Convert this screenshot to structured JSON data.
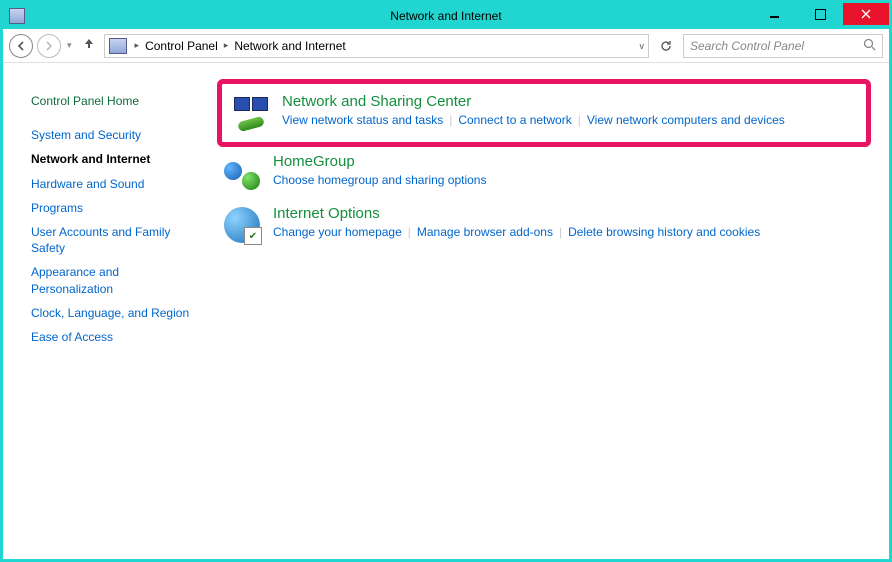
{
  "window": {
    "title": "Network and Internet"
  },
  "breadcrumb": {
    "seg1": "Control Panel",
    "seg2": "Network and Internet"
  },
  "search": {
    "placeholder": "Search Control Panel"
  },
  "sidebar": {
    "home": "Control Panel Home",
    "items": [
      "System and Security",
      "Network and Internet",
      "Hardware and Sound",
      "Programs",
      "User Accounts and Family Safety",
      "Appearance and Personalization",
      "Clock, Language, and Region",
      "Ease of Access"
    ],
    "current_index": 1
  },
  "categories": [
    {
      "title": "Network and Sharing Center",
      "links": [
        "View network status and tasks",
        "Connect to a network",
        "View network computers and devices"
      ]
    },
    {
      "title": "HomeGroup",
      "links": [
        "Choose homegroup and sharing options"
      ]
    },
    {
      "title": "Internet Options",
      "links": [
        "Change your homepage",
        "Manage browser add-ons",
        "Delete browsing history and cookies"
      ]
    }
  ]
}
